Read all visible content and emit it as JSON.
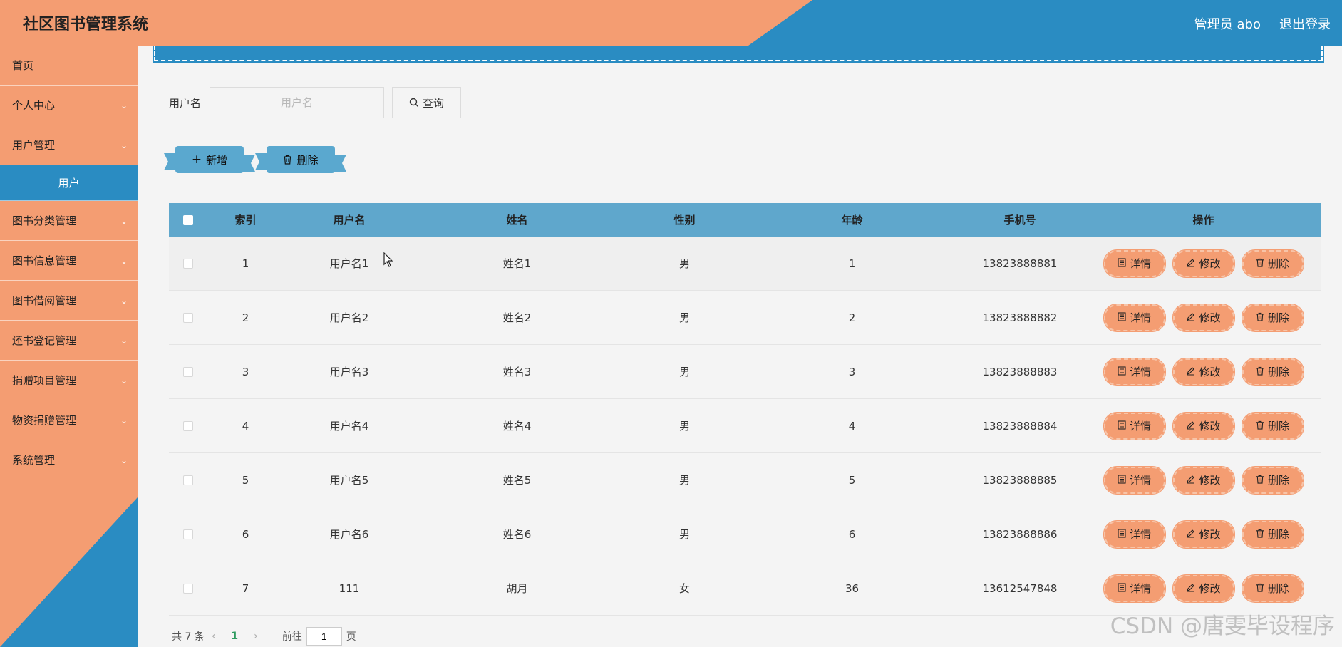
{
  "header": {
    "title": "社区图书管理系统",
    "user": "管理员 abo",
    "logout": "退出登录"
  },
  "colors": {
    "orange": "#f49d72",
    "blue": "#2a8cc2",
    "table_header": "#5fa7cc",
    "page_current": "#2e9b5f"
  },
  "sidebar": {
    "items": [
      {
        "label": "首页",
        "chevron": false
      },
      {
        "label": "个人中心",
        "chevron": true
      },
      {
        "label": "用户管理",
        "chevron": true
      },
      {
        "label": "图书分类管理",
        "chevron": true
      },
      {
        "label": "图书信息管理",
        "chevron": true
      },
      {
        "label": "图书借阅管理",
        "chevron": true
      },
      {
        "label": "还书登记管理",
        "chevron": true
      },
      {
        "label": "捐赠项目管理",
        "chevron": true
      },
      {
        "label": "物资捐赠管理",
        "chevron": true
      },
      {
        "label": "系统管理",
        "chevron": true
      }
    ],
    "active_sub": "用户"
  },
  "search": {
    "label": "用户名",
    "placeholder": "用户名",
    "query_label": "查询",
    "query_icon": "search-icon"
  },
  "actions": {
    "add_label": "新增",
    "delete_label": "删除"
  },
  "table": {
    "headers": {
      "index": "索引",
      "username": "用户名",
      "name": "姓名",
      "gender": "性别",
      "age": "年龄",
      "phone": "手机号",
      "ops": "操作"
    },
    "op_labels": {
      "detail": "详情",
      "edit": "修改",
      "delete": "删除"
    },
    "rows": [
      {
        "index": "1",
        "username": "用户名1",
        "name": "姓名1",
        "gender": "男",
        "age": "1",
        "phone": "13823888881"
      },
      {
        "index": "2",
        "username": "用户名2",
        "name": "姓名2",
        "gender": "男",
        "age": "2",
        "phone": "13823888882"
      },
      {
        "index": "3",
        "username": "用户名3",
        "name": "姓名3",
        "gender": "男",
        "age": "3",
        "phone": "13823888883"
      },
      {
        "index": "4",
        "username": "用户名4",
        "name": "姓名4",
        "gender": "男",
        "age": "4",
        "phone": "13823888884"
      },
      {
        "index": "5",
        "username": "用户名5",
        "name": "姓名5",
        "gender": "男",
        "age": "5",
        "phone": "13823888885"
      },
      {
        "index": "6",
        "username": "用户名6",
        "name": "姓名6",
        "gender": "男",
        "age": "6",
        "phone": "13823888886"
      },
      {
        "index": "7",
        "username": "111",
        "name": "胡月",
        "gender": "女",
        "age": "36",
        "phone": "13612547848"
      }
    ]
  },
  "pagination": {
    "total": "共 7 条",
    "current": "1",
    "goto_label": "前往",
    "goto_value": "1",
    "page_suffix": "页"
  },
  "watermark": "CSDN @唐雯毕设程序"
}
